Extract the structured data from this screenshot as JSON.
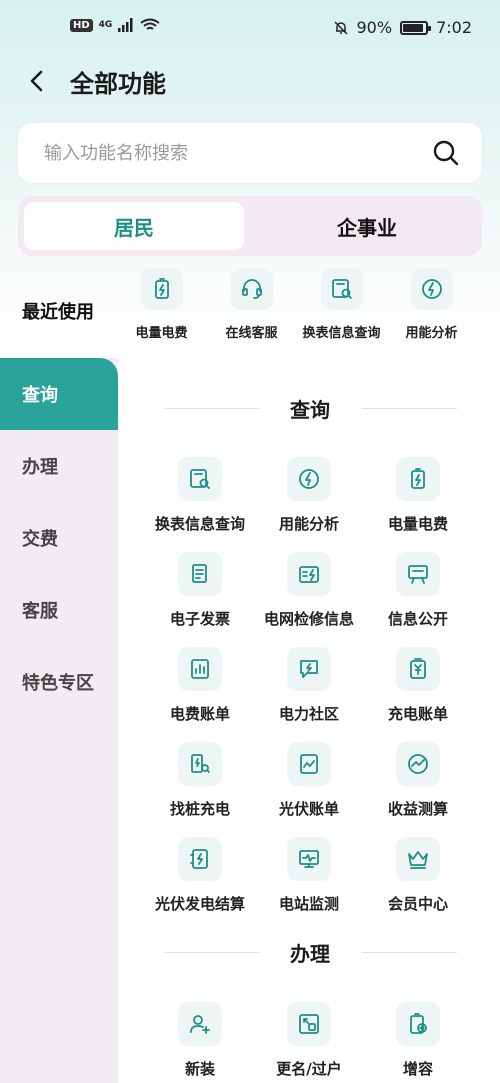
{
  "status_bar": {
    "hd": "HD",
    "network": "4G",
    "battery": "90%",
    "time": "7:02"
  },
  "header": {
    "title": "全部功能"
  },
  "search": {
    "placeholder": "输入功能名称搜索"
  },
  "segments": {
    "residential": "居民",
    "enterprise": "企事业"
  },
  "sidebar": {
    "recent_label": "最近使用",
    "items": [
      {
        "label": "查询"
      },
      {
        "label": "办理"
      },
      {
        "label": "交费"
      },
      {
        "label": "客服"
      },
      {
        "label": "特色专区"
      }
    ]
  },
  "recent": [
    {
      "label": "电量电费",
      "icon": "battery-icon"
    },
    {
      "label": "在线客服",
      "icon": "headset-icon"
    },
    {
      "label": "换表信息查询",
      "icon": "meter-search-icon"
    },
    {
      "label": "用能分析",
      "icon": "energy-icon"
    }
  ],
  "sections": {
    "query": {
      "title": "查询",
      "items": [
        {
          "label": "换表信息查询",
          "icon": "meter-search-icon"
        },
        {
          "label": "用能分析",
          "icon": "energy-icon"
        },
        {
          "label": "电量电费",
          "icon": "battery-icon"
        },
        {
          "label": "电子发票",
          "icon": "invoice-icon"
        },
        {
          "label": "电网检修信息",
          "icon": "grid-repair-icon"
        },
        {
          "label": "信息公开",
          "icon": "board-icon"
        },
        {
          "label": "电费账单",
          "icon": "bill-chart-icon"
        },
        {
          "label": "电力社区",
          "icon": "chat-bolt-icon"
        },
        {
          "label": "充电账单",
          "icon": "yen-bill-icon"
        },
        {
          "label": "找桩充电",
          "icon": "charger-search-icon"
        },
        {
          "label": "光伏账单",
          "icon": "pv-bill-icon"
        },
        {
          "label": "收益测算",
          "icon": "gauge-icon"
        },
        {
          "label": "光伏发电结算",
          "icon": "pv-settle-icon"
        },
        {
          "label": "电站监测",
          "icon": "monitor-icon"
        },
        {
          "label": "会员中心",
          "icon": "crown-icon"
        }
      ]
    },
    "handle": {
      "title": "办理",
      "items": [
        {
          "label": "新装",
          "icon": "user-add-icon"
        },
        {
          "label": "更名/过户",
          "icon": "transfer-icon"
        },
        {
          "label": "增容",
          "icon": "capacity-icon"
        }
      ]
    }
  },
  "colors": {
    "accent": "#2aa49a",
    "icon": "#1f8f85",
    "sidebar_bg": "#f3ebf2"
  }
}
